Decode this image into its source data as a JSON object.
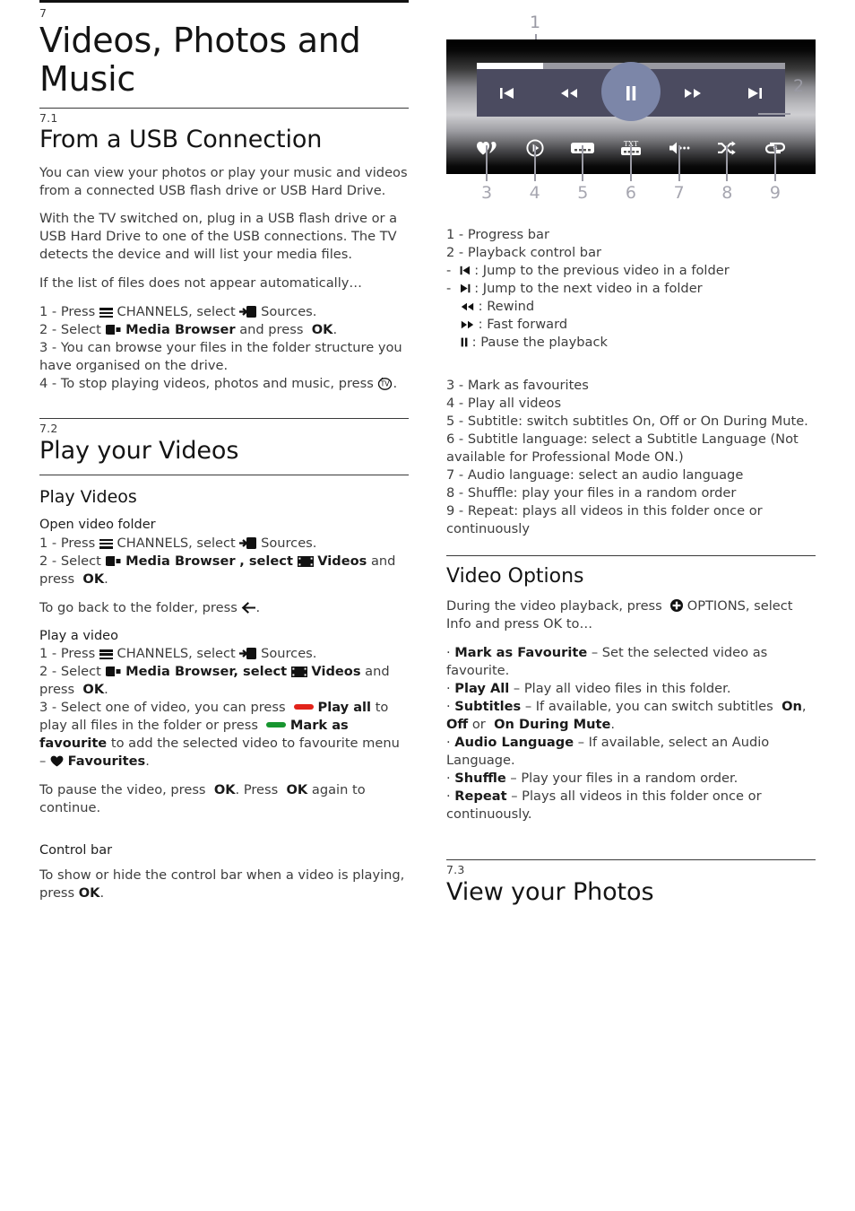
{
  "chapter": {
    "number": "7",
    "title": "Videos, Photos and Music"
  },
  "sections": {
    "usb": {
      "number": "7.1",
      "title": "From a USB Connection",
      "p1": "You can view your photos or play your music and videos from a connected USB flash drive or USB Hard Drive.",
      "p2": "With the TV switched on, plug in a USB flash drive or a USB Hard Drive to one of the USB connections. The TV detects the device and will list your media files.",
      "p3": "If the list of files does not appear automatically…",
      "steps": {
        "s1_a": "1 -  Press",
        "s1_b": "CHANNELS, select",
        "s1_c": "Sources.",
        "s2_a": "2 -  Select",
        "s2_b": "Media Browser",
        "s2_c": "and press",
        "s2_d": "OK",
        "s2_e": ".",
        "s3": "3 -  You can browse your files in the folder structure you have organised on the drive.",
        "s4_a": "4 -  To stop playing videos, photos and music, press",
        "s4_b": "."
      }
    },
    "play_videos": {
      "number": "7.2",
      "title": "Play your Videos",
      "sub": "Play Videos",
      "open_folder": {
        "heading": "Open video folder",
        "s1_a": "1 -  Press",
        "s1_b": "CHANNELS, select",
        "s1_c": "Sources.",
        "s2_a": "2 -  Select",
        "s2_b": "Media Browser",
        "s2_c": ", select",
        "s2_d": "Videos",
        "s2_e": "and press",
        "s2_f": "OK",
        "s2_g": "."
      },
      "go_back_a": "To go back to the folder, press",
      "go_back_b": ".",
      "play_a_video": {
        "heading": "Play a video",
        "s1_a": "1 -  Press",
        "s1_b": "CHANNELS, select",
        "s1_c": "Sources.",
        "s2_a": "2 -  Select",
        "s2_b": "Media Browser, select",
        "s2_c": "Videos",
        "s2_d": "and press",
        "s2_e": "OK",
        "s2_f": ".",
        "s3_a": "3 -  Select one of video, you can press",
        "s3_b": "Play all",
        "s3_c": "to play all files in the folder or press",
        "s3_d": "Mark as favourite",
        "s3_e": "to add the selected video to favourite menu –",
        "s3_f": "Favourites",
        "s3_g": "."
      },
      "pause_a": "To pause the video, press",
      "pause_ok1": "OK",
      "pause_b": ". Press",
      "pause_ok2": "OK",
      "pause_c": "again to continue.",
      "control_bar": {
        "heading": "Control bar",
        "text_a": "To show or hide the control bar when a video is playing, press",
        "text_ok": "OK",
        "text_b": "."
      }
    },
    "view_photos": {
      "number": "7.3",
      "title": "View your Photos"
    }
  },
  "figure": {
    "callouts_top": [
      "1",
      "2"
    ],
    "callouts_bottom": [
      "3",
      "4",
      "5",
      "6",
      "7",
      "8",
      "9"
    ],
    "progress_percent": 21,
    "control_buttons": [
      "previous",
      "rewind",
      "pause",
      "fast-forward",
      "next"
    ],
    "option_buttons": [
      "favourite",
      "play-all",
      "subtitle",
      "teletext",
      "audio-language",
      "shuffle",
      "repeat"
    ],
    "teletext_label": "TXT",
    "colors": {
      "panel": "#4b4b60",
      "halo": "#7c86a8",
      "progress_fill": "#ffffff",
      "progress_track": "#9a9aa2",
      "callout": "#9a9aa4"
    }
  },
  "legend": {
    "item1": "1 -  Progress bar",
    "item2": "2 -  Playback control bar",
    "sub_prev_a": "-",
    "sub_prev_b": ": Jump to the previous video in a folder",
    "sub_next_a": "-",
    "sub_next_b": ": Jump to the next video in a folder",
    "sub_rew": ": Rewind",
    "sub_ff": ": Fast forward",
    "sub_pause": ": Pause the playback",
    "item3": "3 -  Mark as favourites",
    "item4": "4 -  Play all videos",
    "item5": "5 -  Subtitle: switch subtitles On, Off or On During Mute.",
    "item6": "6 -  Subtitle language: select a Subtitle Language (Not available for Professional Mode ON.)",
    "item7": "7 -  Audio language: select an audio language",
    "item8": "8 -  Shuffle: play your files in a random order",
    "item9": "9 -  Repeat: plays all videos in this folder once or continuously"
  },
  "video_options": {
    "title": "Video Options",
    "intro_a": "During the video playback, press",
    "intro_b": "OPTIONS, select Info and press OK to…",
    "bullets": {
      "b1_name": "Mark as Favourite",
      "b1_desc": "– Set the selected video as favourite.",
      "b2_name": "Play All",
      "b2_desc": "– Play all video files in this folder.",
      "b3_name": "Subtitles",
      "b3_desc_a": "– If available, you can switch subtitles",
      "b3_on": "On",
      "b3_comma": ",",
      "b3_off": "Off",
      "b3_or": "or",
      "b3_mute": "On During Mute",
      "b3_end": ".",
      "b4_name": "Audio Language",
      "b4_desc": "– If available, select an Audio Language.",
      "b5_name": "Shuffle",
      "b5_desc": "– Play your files in a random order.",
      "b6_name": "Repeat",
      "b6_desc": "– Plays all videos in this folder once or continuously."
    }
  }
}
